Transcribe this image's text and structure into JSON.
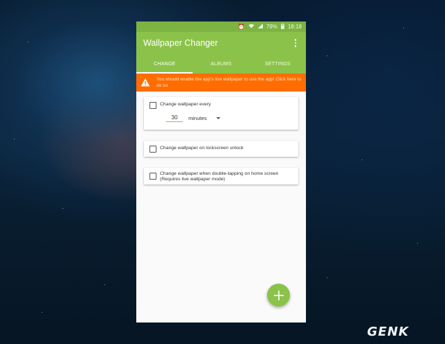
{
  "status_bar": {
    "battery": "79%",
    "time": "18:18"
  },
  "app": {
    "title": "Wallpaper Changer",
    "menu_icon": "more-vert-icon"
  },
  "tabs": [
    {
      "label": "CHANGE",
      "active": true
    },
    {
      "label": "ALBUMS",
      "active": false
    },
    {
      "label": "SETTINGS",
      "active": false
    }
  ],
  "banner": {
    "icon": "warning-icon",
    "text": "You should enable the app's live wallpaper to use the app! Click here to do so",
    "color": "#ff6d00"
  },
  "options": {
    "change_every": {
      "label": "Change wallpaper every",
      "checked": false,
      "interval_value": "30",
      "interval_unit": "minutes"
    },
    "lockscreen": {
      "label": "Change wallpaper on lockscreen unlock",
      "checked": false
    },
    "double_tap": {
      "label": "Change wallpaper when double-tapping on home screen (Requires live wallpaper mode)",
      "checked": false
    }
  },
  "fab": {
    "icon": "plus-icon"
  },
  "watermark": {
    "text": "GENK"
  },
  "colors": {
    "primary": "#8bc34a",
    "status_bar": "#7cb342",
    "warning": "#ff6d00"
  }
}
